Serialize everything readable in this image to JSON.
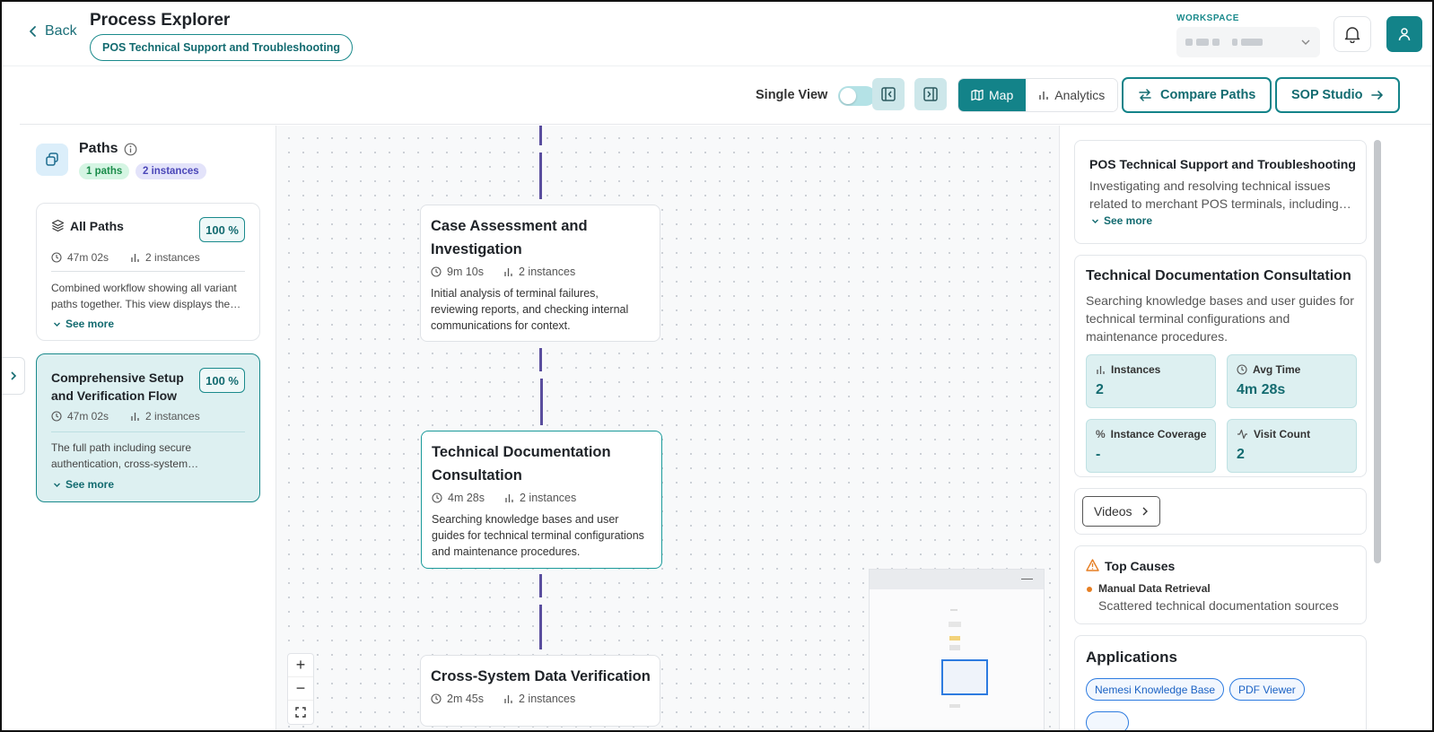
{
  "header": {
    "back_label": "Back",
    "title": "Process Explorer",
    "process_chip": "POS Technical Support and Troubleshooting",
    "workspace_label": "WORKSPACE"
  },
  "toolbar": {
    "single_view_label": "Single View",
    "single_view_on": false,
    "map_label": "Map",
    "analytics_label": "Analytics",
    "compare_label": "Compare Paths",
    "sop_label": "SOP Studio"
  },
  "paths_panel": {
    "title": "Paths",
    "paths_badge": "1 paths",
    "instances_badge": "2 instances",
    "cards": [
      {
        "title": "All Paths",
        "percent": "100 %",
        "time": "47m 02s",
        "instances": "2 instances",
        "description": "Combined workflow showing all variant paths together. This view displays the…",
        "see_more": "See more"
      },
      {
        "title": "Comprehensive Setup and Verification Flow",
        "percent": "100 %",
        "time": "47m 02s",
        "instances": "2 instances",
        "description": "The full path including secure authentication, cross-system…",
        "see_more": "See more"
      }
    ]
  },
  "canvas": {
    "nodes": [
      {
        "title": "Case Assessment and Investigation",
        "time": "9m 10s",
        "instances": "2 instances",
        "description": "Initial analysis of terminal failures, reviewing reports, and checking internal communications for context."
      },
      {
        "title": "Technical Documentation Consultation",
        "time": "4m 28s",
        "instances": "2 instances",
        "description": "Searching knowledge bases and user guides for technical terminal configurations and maintenance procedures."
      },
      {
        "title": "Cross-System Data Verification",
        "time": "2m 45s",
        "instances": "2 instances"
      }
    ],
    "zoom_in": "+",
    "zoom_out": "−",
    "minimap_collapse": "—"
  },
  "details": {
    "process_title": "POS Technical Support and Troubleshooting",
    "process_desc": "Investigating and resolving technical issues related to merchant POS terminals, including…",
    "see_more": "See more",
    "step_title": "Technical Documentation Consultation",
    "step_desc": "Searching knowledge bases and user guides for technical terminal configurations and maintenance procedures.",
    "stats": {
      "instances_label": "Instances",
      "instances_value": "2",
      "avg_label": "Avg Time",
      "avg_value": "4m 28s",
      "coverage_label": "Instance Coverage",
      "coverage_value": "-",
      "visit_label": "Visit Count",
      "visit_value": "2"
    },
    "videos_label": "Videos",
    "top_causes_title": "Top Causes",
    "cause_name": "Manual Data Retrieval",
    "cause_desc": "Scattered technical documentation sources",
    "applications_title": "Applications",
    "applications": [
      "Nemesi Knowledge Base",
      "PDF Viewer"
    ]
  },
  "colors": {
    "accent": "#138389",
    "edge": "#5a4e9e",
    "warning": "#e67e22"
  }
}
